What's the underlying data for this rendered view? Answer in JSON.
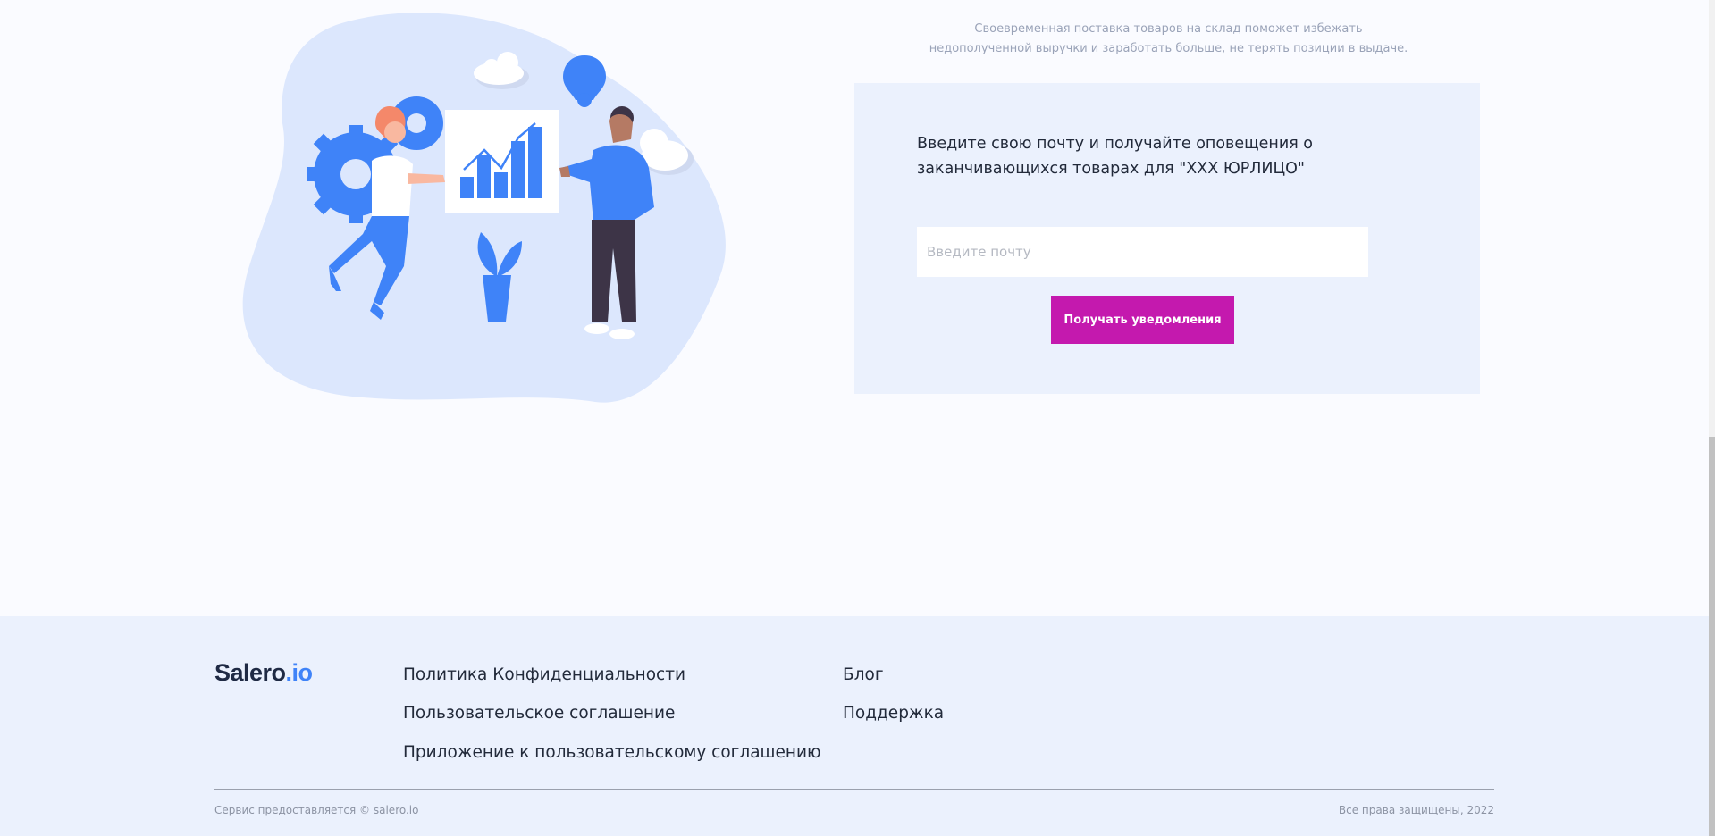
{
  "subtitle": {
    "line1": "Своевременная поставка товаров на склад поможет избежать",
    "line2": "недополученной выручки и заработать больше, не терять позиции в выдаче."
  },
  "notify": {
    "text_line1": "Введите свою почту и получайте оповещения о",
    "text_line2": "заканчивающихся товарах для \"ХХХ ЮРЛИЦО\"",
    "email_placeholder": "Введите почту",
    "email_value": "",
    "button_label": "Получать уведомления"
  },
  "footer": {
    "logo_main": "Salero",
    "logo_accent": ".io",
    "links_col1": [
      "Политика Конфиденциальности",
      "Пользовательское соглашение",
      "Приложение к пользовательскому соглашению"
    ],
    "links_col2": [
      "Блог",
      "Поддержка"
    ],
    "copyright_left": "Сервис предоставляется © salero.io",
    "copyright_right": "Все права защищены, 2022"
  },
  "colors": {
    "accent_button": "#c419ae",
    "brand_blue": "#3f83f8",
    "card_background": "#ebf1fd"
  },
  "illustration": {
    "description_icon": "team-analytics-illustration"
  }
}
